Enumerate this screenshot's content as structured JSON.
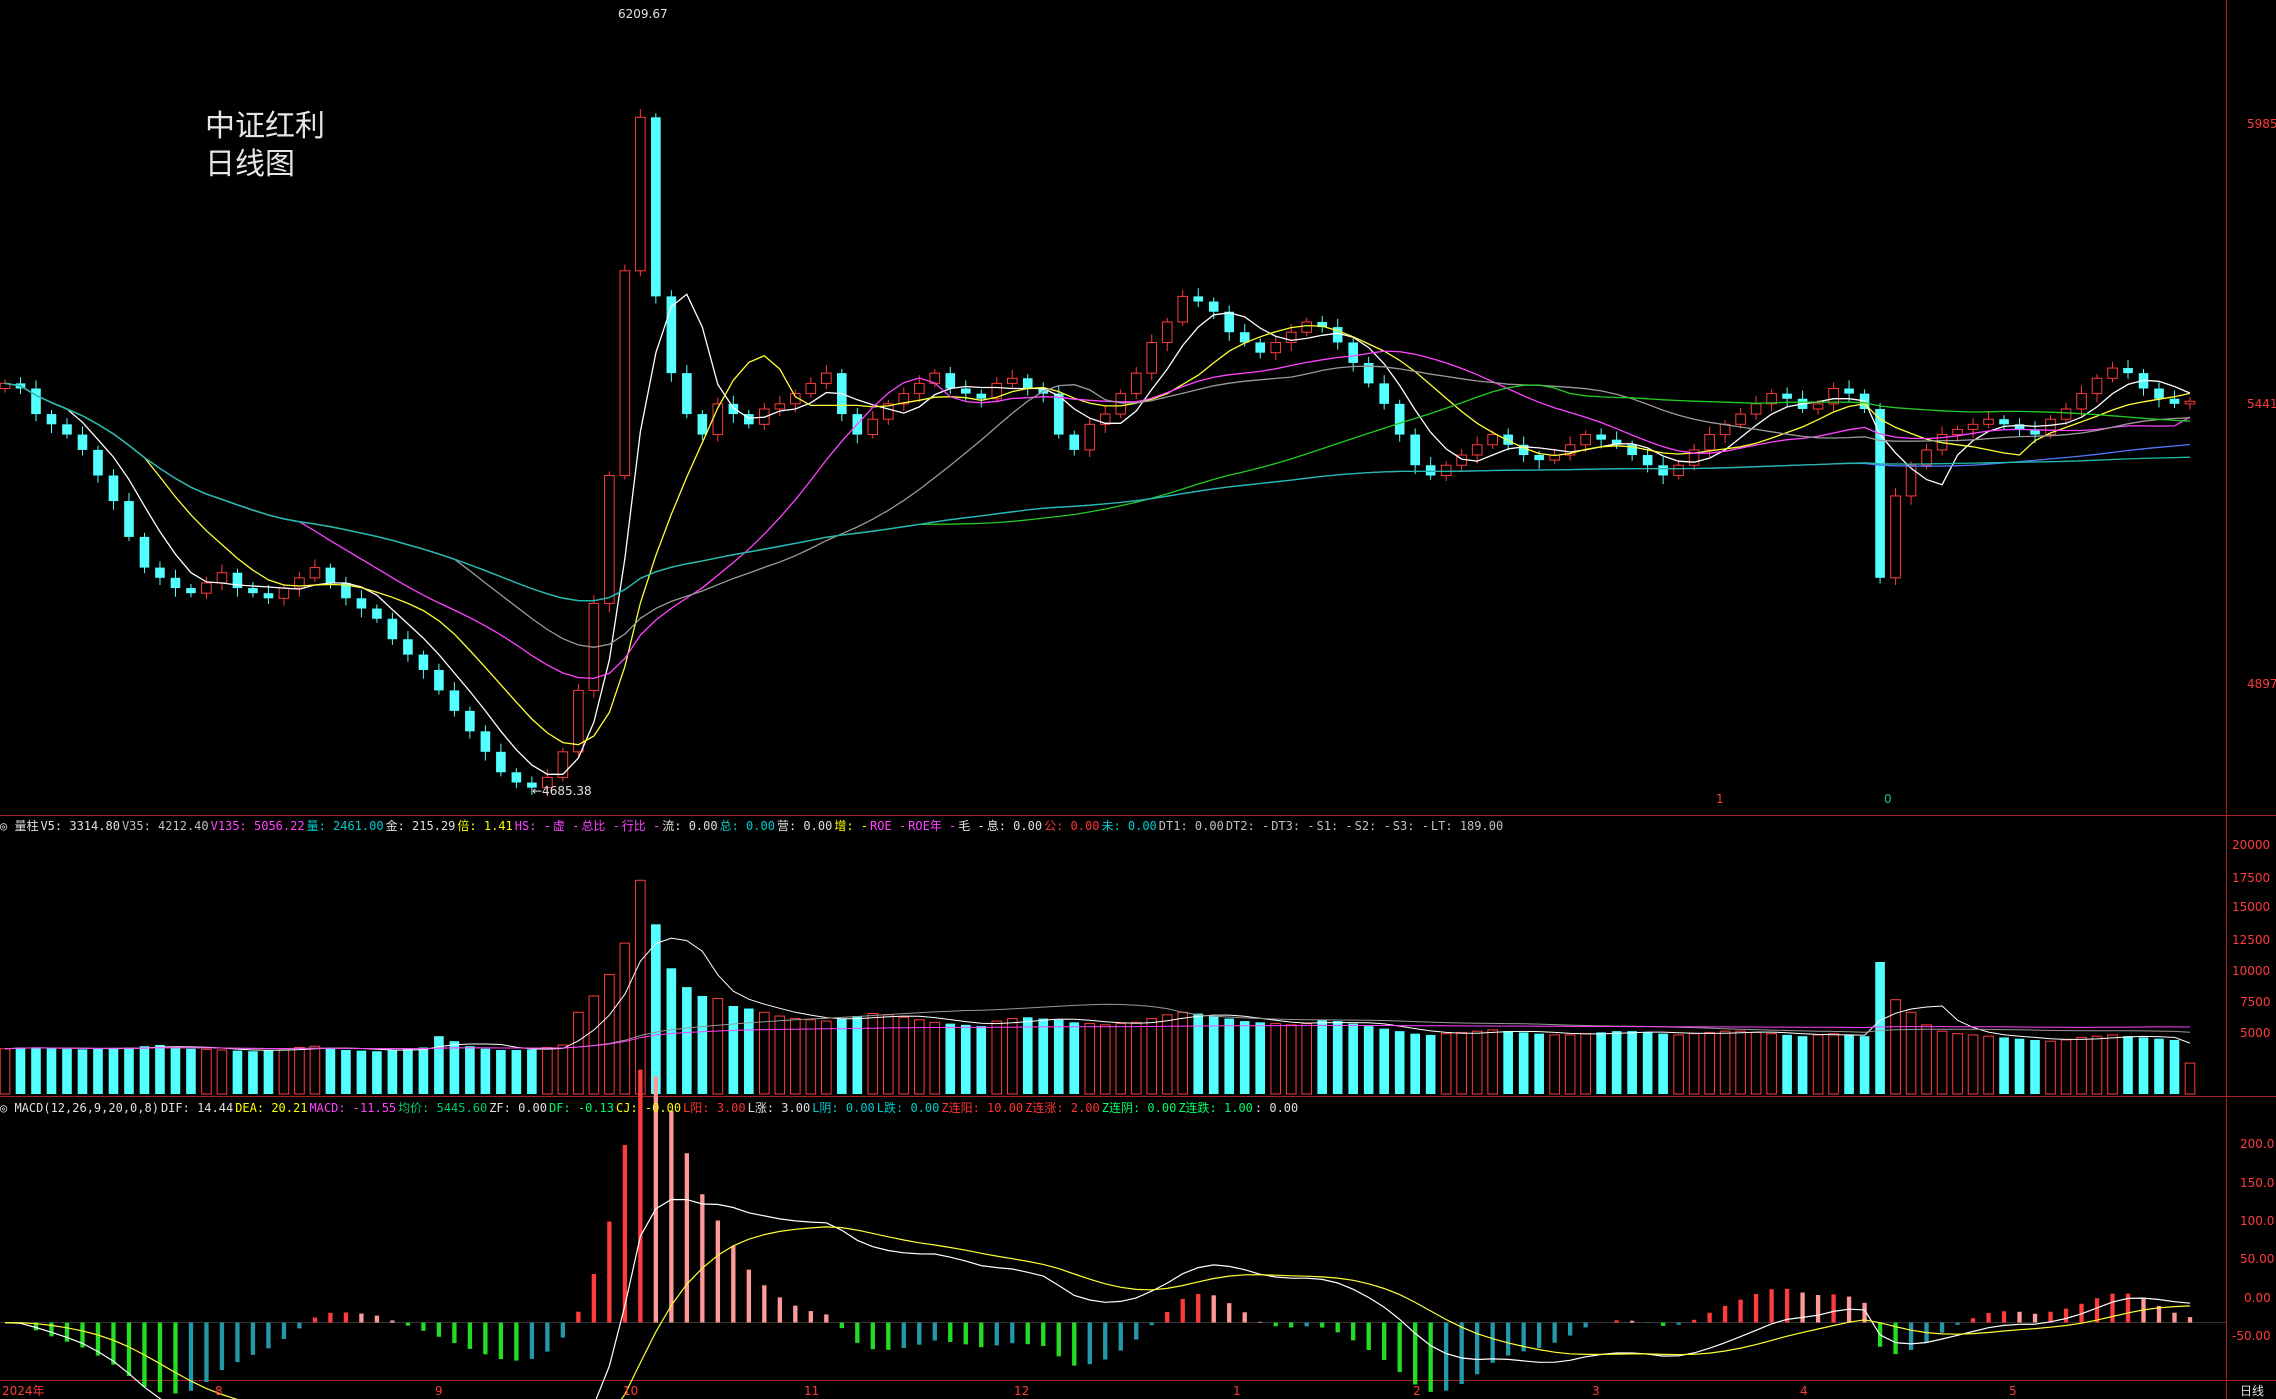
{
  "chart_title_line1": "中证红利",
  "chart_title_line2": "日线图",
  "price_panel": {
    "high_label": "6209.67",
    "low_label": "←4685.38",
    "y_ticks": [
      "5985",
      "5441",
      "4897"
    ],
    "marker_1": "1",
    "marker_0": "0"
  },
  "volume_panel": {
    "info": [
      {
        "text": "◎ 量柱",
        "color": "#e0e0e0"
      },
      {
        "text": "V5: 3314.80",
        "color": "#e0e0e0"
      },
      {
        "text": "V35: 4212.40",
        "color": "#c0c0c0"
      },
      {
        "text": "V135: 5056.22",
        "color": "#ff44ff"
      },
      {
        "text": "量: 2461.00",
        "color": "#00cccc"
      },
      {
        "text": "金: 215.29",
        "color": "#e0e0e0"
      },
      {
        "text": "倍: 1.41",
        "color": "#ffff00"
      },
      {
        "text": "HS: -",
        "color": "#ff44ff"
      },
      {
        "text": "虚 -",
        "color": "#ff44ff"
      },
      {
        "text": "总比 -",
        "color": "#ff44ff"
      },
      {
        "text": "行比 -",
        "color": "#ff44ff"
      },
      {
        "text": "流: 0.00",
        "color": "#e0e0e0"
      },
      {
        "text": "总: 0.00",
        "color": "#00cccc"
      },
      {
        "text": "营: 0.00",
        "color": "#e0e0e0"
      },
      {
        "text": "增: -",
        "color": "#ffff00"
      },
      {
        "text": "ROE -",
        "color": "#ff44ff"
      },
      {
        "text": "ROE年 -",
        "color": "#ff44ff"
      },
      {
        "text": "毛 -",
        "color": "#e0e0e0"
      },
      {
        "text": "息: 0.00",
        "color": "#e0e0e0"
      },
      {
        "text": "公: 0.00",
        "color": "#ff3333"
      },
      {
        "text": "未: 0.00",
        "color": "#00cccc"
      },
      {
        "text": "DT1: 0.00",
        "color": "#c0c0c0"
      },
      {
        "text": "DT2: -",
        "color": "#c0c0c0"
      },
      {
        "text": "DT3: -",
        "color": "#c0c0c0"
      },
      {
        "text": "S1: -",
        "color": "#c0c0c0"
      },
      {
        "text": "S2: -",
        "color": "#c0c0c0"
      },
      {
        "text": "S3: -",
        "color": "#c0c0c0"
      },
      {
        "text": "LT: 189.00",
        "color": "#c0c0c0"
      }
    ],
    "y_ticks": [
      "20000",
      "17500",
      "15000",
      "12500",
      "10000",
      "7500",
      "5000"
    ]
  },
  "macd_panel": {
    "info": [
      {
        "text": "◎ MACD(12,26,9,20,0,8)",
        "color": "#e0e0e0"
      },
      {
        "text": "DIF: 14.44",
        "color": "#e0e0e0"
      },
      {
        "text": "DEA: 20.21",
        "color": "#ffff00"
      },
      {
        "text": "MACD: -11.55",
        "color": "#ff44ff"
      },
      {
        "text": "均价: 5445.60",
        "color": "#00cc66"
      },
      {
        "text": "ZF: 0.00",
        "color": "#e0e0e0"
      },
      {
        "text": "DF: -0.13",
        "color": "#00ff66"
      },
      {
        "text": "CJ: -0.00",
        "color": "#ffff00"
      },
      {
        "text": "L阳: 3.00",
        "color": "#ff3333"
      },
      {
        "text": "L涨: 3.00",
        "color": "#e0e0e0"
      },
      {
        "text": "L阴: 0.00",
        "color": "#00cccc"
      },
      {
        "text": "L跌: 0.00",
        "color": "#00cccc"
      },
      {
        "text": "Z连阳: 10.00",
        "color": "#ff3333"
      },
      {
        "text": "Z连涨: 2.00",
        "color": "#ff3333"
      },
      {
        "text": "Z连阴: 0.00",
        "color": "#00ff66"
      },
      {
        "text": "Z连跌: 1.00",
        "color": "#00ff66"
      },
      {
        "text": ": 0.00",
        "color": "#e0e0e0"
      }
    ],
    "y_ticks": [
      "200.0",
      "150.0",
      "100.0",
      "50.00",
      "0.00",
      "-50.00"
    ]
  },
  "date_axis": {
    "labels": [
      "2024年",
      "8",
      "9",
      "10",
      "11",
      "12",
      "1",
      "2",
      "3",
      "4",
      "5"
    ],
    "period_label": "日线"
  },
  "colors": {
    "up": "#ff3b3b",
    "down": "#54ffff",
    "ma_white": "#ffffff",
    "ma_yellow": "#ffff33",
    "ma_magenta": "#ff44ff",
    "ma_green": "#22cc22",
    "ma_gray": "#999999",
    "ma_blue": "#5577ff",
    "ma_teal": "#22bbaa",
    "border": "#aa2222",
    "axis_text": "#ff3b3b"
  },
  "chart_data": {
    "type": "candlestick",
    "close_series": [
      5480,
      5470,
      5420,
      5400,
      5380,
      5350,
      5300,
      5250,
      5180,
      5120,
      5100,
      5080,
      5070,
      5090,
      5110,
      5080,
      5070,
      5060,
      5080,
      5100,
      5120,
      5090,
      5060,
      5040,
      5020,
      4980,
      4950,
      4920,
      4880,
      4840,
      4800,
      4760,
      4720,
      4700,
      4690,
      4710,
      4760,
      4880,
      5050,
      5300,
      5700,
      6000,
      5650,
      5500,
      5420,
      5380,
      5440,
      5420,
      5400,
      5430,
      5440,
      5460,
      5480,
      5500,
      5420,
      5380,
      5410,
      5440,
      5460,
      5480,
      5500,
      5470,
      5460,
      5450,
      5480,
      5490,
      5470,
      5460,
      5380,
      5350,
      5400,
      5420,
      5460,
      5500,
      5560,
      5600,
      5650,
      5640,
      5620,
      5580,
      5560,
      5540,
      5560,
      5580,
      5600,
      5590,
      5560,
      5520,
      5480,
      5440,
      5380,
      5320,
      5300,
      5320,
      5340,
      5360,
      5380,
      5360,
      5340,
      5330,
      5340,
      5360,
      5380,
      5370,
      5360,
      5340,
      5320,
      5300,
      5320,
      5350,
      5380,
      5400,
      5420,
      5440,
      5460,
      5450,
      5430,
      5440,
      5470,
      5460,
      5430,
      5100,
      5260,
      5320,
      5350,
      5380,
      5390,
      5400,
      5410,
      5400,
      5390,
      5380,
      5410,
      5430,
      5460,
      5490,
      5510,
      5500,
      5470,
      5450,
      5440,
      5445
    ],
    "price_range": [
      4685.38,
      6209.67
    ],
    "volume_values": [
      3600,
      3700,
      3700,
      3650,
      3600,
      3550,
      3600,
      3650,
      3700,
      3800,
      3900,
      3750,
      3600,
      3550,
      3500,
      3450,
      3400,
      3500,
      3600,
      3700,
      3800,
      3650,
      3500,
      3450,
      3400,
      3500,
      3600,
      3700,
      4600,
      4200,
      3800,
      3600,
      3500,
      3500,
      3550,
      3700,
      3900,
      6500,
      7800,
      9500,
      12000,
      17000,
      13500,
      10000,
      8500,
      7800,
      7600,
      7000,
      6800,
      6500,
      6200,
      6000,
      5900,
      5800,
      6000,
      6200,
      6400,
      6300,
      6100,
      5900,
      5700,
      5600,
      5500,
      5400,
      5800,
      6000,
      6100,
      6000,
      5900,
      5700,
      5600,
      5500,
      5600,
      5700,
      6000,
      6300,
      6500,
      6400,
      6200,
      6000,
      5800,
      5700,
      5600,
      5500,
      5600,
      5900,
      5800,
      5600,
      5400,
      5200,
      5000,
      4800,
      4700,
      4800,
      4900,
      5000,
      5100,
      5000,
      4900,
      4800,
      4700,
      4700,
      4800,
      4900,
      5000,
      5000,
      4900,
      4800,
      4700,
      4800,
      4900,
      5000,
      5000,
      4900,
      4800,
      4700,
      4600,
      4700,
      4800,
      4700,
      4600,
      10500,
      7500,
      6500,
      5500,
      5000,
      4800,
      4700,
      4600,
      4500,
      4400,
      4300,
      4200,
      4300,
      4500,
      4600,
      4700,
      4600,
      4500,
      4400,
      4300,
      2461
    ],
    "volume_ma": {
      "V5": 3314.8,
      "V35": 4212.4,
      "V135": 5056.22
    },
    "macd": {
      "DIF": 14.44,
      "DEA": 20.21,
      "MACD": -11.55
    },
    "macd_range": [
      -60,
      230
    ],
    "volume_range": [
      0,
      21000
    ]
  }
}
